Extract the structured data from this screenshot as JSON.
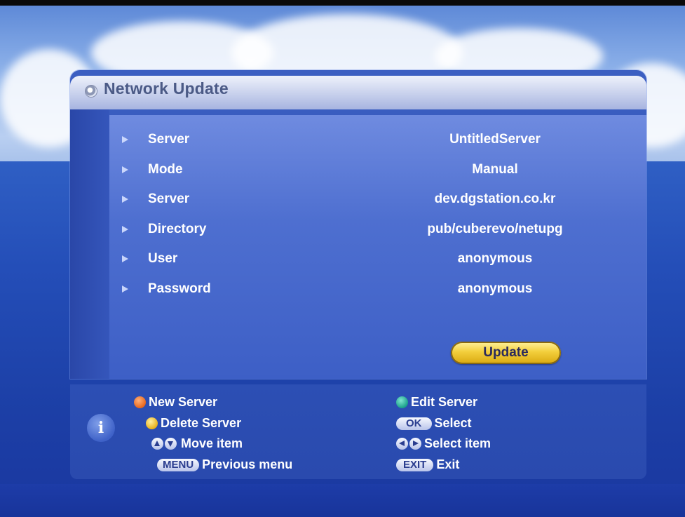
{
  "window": {
    "title": "Network Update"
  },
  "settings": [
    {
      "label": "Server",
      "value": "UntitledServer"
    },
    {
      "label": "Mode",
      "value": "Manual"
    },
    {
      "label": "Server",
      "value": "dev.dgstation.co.kr"
    },
    {
      "label": "Directory",
      "value": "pub/cuberevo/netupg"
    },
    {
      "label": "User",
      "value": "anonymous"
    },
    {
      "label": "Password",
      "value": "anonymous"
    }
  ],
  "update_button": {
    "label": "Update"
  },
  "help": {
    "info_glyph": "i",
    "new_server": {
      "label": "New Server",
      "color": "#e8661c"
    },
    "edit_server": {
      "label": "Edit Server",
      "color": "#1aa08a"
    },
    "delete_server": {
      "label": "Delete Server",
      "color": "#e9b11a"
    },
    "ok": {
      "key": "OK",
      "label": "Select"
    },
    "move": {
      "label": "Move item"
    },
    "select_item": {
      "label": "Select item"
    },
    "menu": {
      "key": "MENU",
      "label": "Previous menu"
    },
    "exit": {
      "key": "EXIT",
      "label": "Exit"
    }
  },
  "colors": {
    "panel_blue": "#3556bb",
    "title_text": "#4b5a86",
    "update_yellow": "#f3cf3c"
  }
}
